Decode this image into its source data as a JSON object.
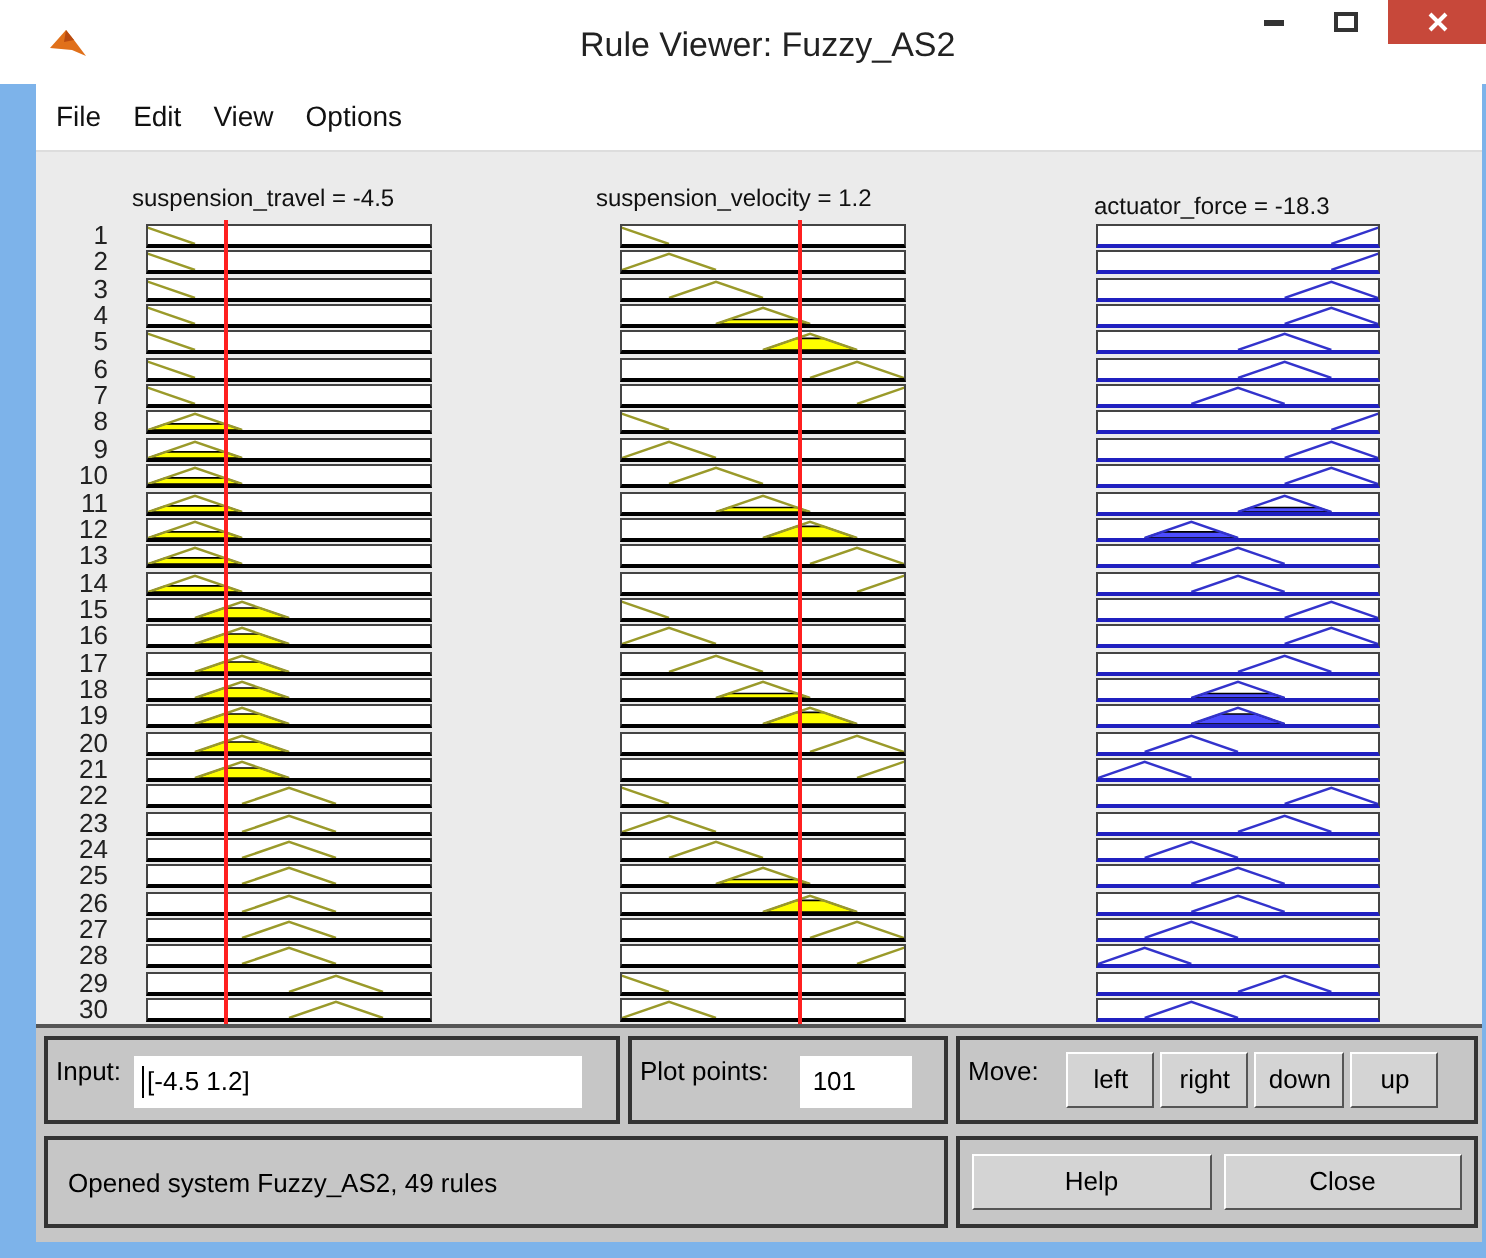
{
  "window": {
    "title": "Rule Viewer: Fuzzy_AS2"
  },
  "menu": [
    {
      "label": "File"
    },
    {
      "label": "Edit"
    },
    {
      "label": "View"
    },
    {
      "label": "Options"
    }
  ],
  "variables": [
    {
      "label": "suspension_travel = -4.5",
      "kind": "input",
      "marker": {
        "level": 0.27
      }
    },
    {
      "label": "suspension_velocity = 1.2",
      "kind": "input",
      "marker": {
        "level": 0.62
      }
    },
    {
      "label": "actuator_force = -18.3",
      "kind": "output"
    }
  ],
  "rules": [
    {
      "number": "1",
      "cells": [
        {
          "kind": "mf1"
        },
        {
          "kind": "mf1"
        },
        {
          "kind": "mf7"
        }
      ]
    },
    {
      "number": "2",
      "cells": [
        {
          "kind": "mf1"
        },
        {
          "kind": "mf2"
        },
        {
          "kind": "mf7"
        }
      ]
    },
    {
      "number": "3",
      "cells": [
        {
          "kind": "mf1"
        },
        {
          "kind": "mf3"
        },
        {
          "kind": "mf6"
        }
      ]
    },
    {
      "number": "4",
      "cells": [
        {
          "kind": "mf1"
        },
        {
          "kind": "mf4"
        },
        {
          "kind": "mf6"
        }
      ]
    },
    {
      "number": "5",
      "cells": [
        {
          "kind": "mf1"
        },
        {
          "kind": "mf5"
        },
        {
          "kind": "mf5"
        }
      ]
    },
    {
      "number": "6",
      "cells": [
        {
          "kind": "mf1"
        },
        {
          "kind": "mf6"
        },
        {
          "kind": "mf5"
        }
      ]
    },
    {
      "number": "7",
      "cells": [
        {
          "kind": "mf1"
        },
        {
          "kind": "mf7"
        },
        {
          "kind": "mf4"
        }
      ]
    },
    {
      "number": "8",
      "cells": [
        {
          "kind": "mf2"
        },
        {
          "kind": "mf1"
        },
        {
          "kind": "mf7"
        }
      ]
    },
    {
      "number": "9",
      "cells": [
        {
          "kind": "mf2"
        },
        {
          "kind": "mf2"
        },
        {
          "kind": "mf6"
        }
      ]
    },
    {
      "number": "10",
      "cells": [
        {
          "kind": "mf2"
        },
        {
          "kind": "mf3"
        },
        {
          "kind": "mf6"
        }
      ]
    },
    {
      "number": "11",
      "cells": [
        {
          "kind": "mf2"
        },
        {
          "kind": "mf4"
        },
        {
          "kind": "mf5"
        }
      ]
    },
    {
      "number": "12",
      "cells": [
        {
          "kind": "mf2"
        },
        {
          "kind": "mf5"
        },
        {
          "kind": "mf3"
        }
      ]
    },
    {
      "number": "13",
      "cells": [
        {
          "kind": "mf2"
        },
        {
          "kind": "mf6"
        },
        {
          "kind": "mf4"
        }
      ]
    },
    {
      "number": "14",
      "cells": [
        {
          "kind": "mf2"
        },
        {
          "kind": "mf7"
        },
        {
          "kind": "mf4"
        }
      ]
    },
    {
      "number": "15",
      "cells": [
        {
          "kind": "mf3"
        },
        {
          "kind": "mf1"
        },
        {
          "kind": "mf6"
        }
      ]
    },
    {
      "number": "16",
      "cells": [
        {
          "kind": "mf3"
        },
        {
          "kind": "mf2"
        },
        {
          "kind": "mf6"
        }
      ]
    },
    {
      "number": "17",
      "cells": [
        {
          "kind": "mf3"
        },
        {
          "kind": "mf3"
        },
        {
          "kind": "mf5"
        }
      ]
    },
    {
      "number": "18",
      "cells": [
        {
          "kind": "mf3"
        },
        {
          "kind": "mf4"
        },
        {
          "kind": "mf4"
        }
      ]
    },
    {
      "number": "19",
      "cells": [
        {
          "kind": "mf3"
        },
        {
          "kind": "mf5"
        },
        {
          "kind": "mf4"
        }
      ]
    },
    {
      "number": "20",
      "cells": [
        {
          "kind": "mf3"
        },
        {
          "kind": "mf6"
        },
        {
          "kind": "mf3"
        }
      ]
    },
    {
      "number": "21",
      "cells": [
        {
          "kind": "mf3"
        },
        {
          "kind": "mf7"
        },
        {
          "kind": "mf2"
        }
      ]
    },
    {
      "number": "22",
      "cells": [
        {
          "kind": "mf4"
        },
        {
          "kind": "mf1"
        },
        {
          "kind": "mf6"
        }
      ]
    },
    {
      "number": "23",
      "cells": [
        {
          "kind": "mf4"
        },
        {
          "kind": "mf2"
        },
        {
          "kind": "mf5"
        }
      ]
    },
    {
      "number": "24",
      "cells": [
        {
          "kind": "mf4"
        },
        {
          "kind": "mf3"
        },
        {
          "kind": "mf3"
        }
      ]
    },
    {
      "number": "25",
      "cells": [
        {
          "kind": "mf4"
        },
        {
          "kind": "mf4"
        },
        {
          "kind": "mf4"
        }
      ]
    },
    {
      "number": "26",
      "cells": [
        {
          "kind": "mf4"
        },
        {
          "kind": "mf5"
        },
        {
          "kind": "mf4"
        }
      ]
    },
    {
      "number": "27",
      "cells": [
        {
          "kind": "mf4"
        },
        {
          "kind": "mf6"
        },
        {
          "kind": "mf3"
        }
      ]
    },
    {
      "number": "28",
      "cells": [
        {
          "kind": "mf4"
        },
        {
          "kind": "mf7"
        },
        {
          "kind": "mf2"
        }
      ]
    },
    {
      "number": "29",
      "cells": [
        {
          "kind": "mf5"
        },
        {
          "kind": "mf1"
        },
        {
          "kind": "mf5"
        }
      ]
    },
    {
      "number": "30",
      "cells": [
        {
          "kind": "mf5"
        },
        {
          "kind": "mf2"
        },
        {
          "kind": "mf3"
        }
      ]
    }
  ],
  "input": {
    "label": "Input:",
    "value": "[-4.5 1.2]"
  },
  "plot_points": {
    "label": "Plot points:",
    "value": "101"
  },
  "move": {
    "label": "Move:",
    "buttons": [
      {
        "label": "left"
      },
      {
        "label": "right"
      },
      {
        "label": "down"
      },
      {
        "label": "up"
      }
    ]
  },
  "status": "Opened system Fuzzy_AS2, 49 rules",
  "buttons": [
    {
      "label": "Help"
    },
    {
      "label": "Close"
    }
  ]
}
